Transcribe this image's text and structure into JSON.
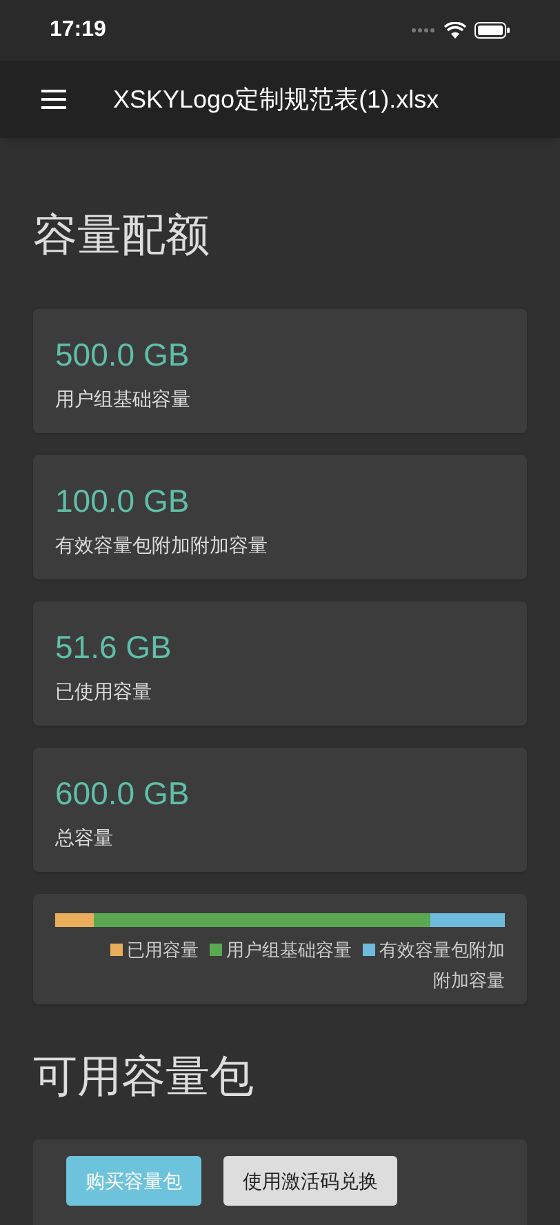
{
  "status_bar": {
    "time": "17:19"
  },
  "header": {
    "title": "XSKYLogo定制规范表(1).xlsx"
  },
  "quota": {
    "title": "容量配额",
    "cards": [
      {
        "value": "500.0 GB",
        "label": "用户组基础容量"
      },
      {
        "value": "100.0 GB",
        "label": "有效容量包附加附加容量"
      },
      {
        "value": "51.6 GB",
        "label": "已使用容量"
      },
      {
        "value": "600.0 GB",
        "label": "总容量"
      }
    ],
    "usage_bar": {
      "segments": [
        {
          "color": "#e9ae5c"
        },
        {
          "color": "#5aa952"
        },
        {
          "color": "#6fbbdc"
        }
      ],
      "legend": [
        {
          "label": "已用容量",
          "color": "#e9ae5c"
        },
        {
          "label": "用户组基础容量",
          "color": "#5aa952"
        },
        {
          "label": "有效容量包附加附加容量",
          "color": "#6fbbdc"
        }
      ]
    }
  },
  "packs": {
    "title": "可用容量包",
    "buttons": [
      {
        "label": "购买容量包",
        "kind": "primary"
      },
      {
        "label": "使用激活码兑换",
        "kind": "secondary"
      }
    ]
  }
}
